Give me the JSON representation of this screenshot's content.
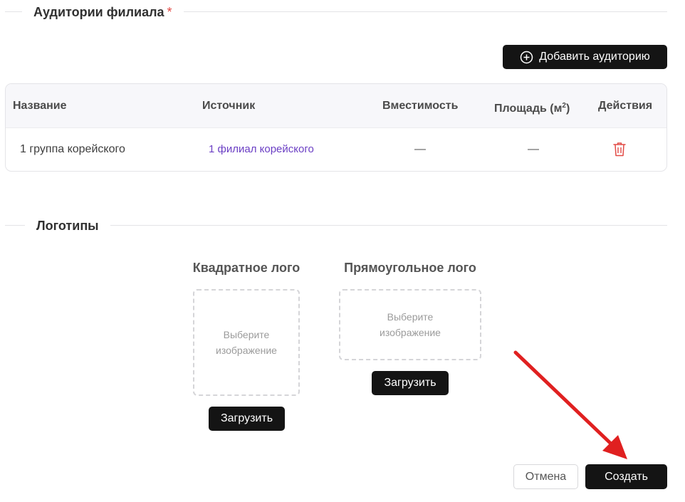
{
  "classrooms_section": {
    "title": "Аудитории филиала",
    "required_mark": "*",
    "add_button_label": "Добавить аудиторию"
  },
  "table": {
    "headers": {
      "name": "Название",
      "source": "Источник",
      "capacity": "Вместимость",
      "area": "Площадь (м",
      "area_sup": "2",
      "area_close": ")",
      "actions": "Действия"
    },
    "rows": [
      {
        "name": "1 группа корейского",
        "source": "1 филиал корейского",
        "capacity": "—",
        "area": "—"
      }
    ]
  },
  "logos_section": {
    "title": "Логотипы",
    "square": {
      "title": "Квадратное лого",
      "placeholder_line1": "Выберите",
      "placeholder_line2": "изображение",
      "upload_label": "Загрузить"
    },
    "rectangular": {
      "title": "Прямоугольное лого",
      "placeholder_line1": "Выберите",
      "placeholder_line2": "изображение",
      "upload_label": "Загрузить"
    }
  },
  "footer": {
    "cancel_label": "Отмена",
    "create_label": "Создать"
  },
  "colors": {
    "accent_dark": "#141414",
    "link_purple": "#6b3fc4",
    "danger_red": "#e24a45",
    "annotation_arrow": "#e02020"
  },
  "icons": {
    "add": "plus-circle-icon",
    "delete": "trash-icon",
    "annotation": "red-arrow-icon"
  }
}
